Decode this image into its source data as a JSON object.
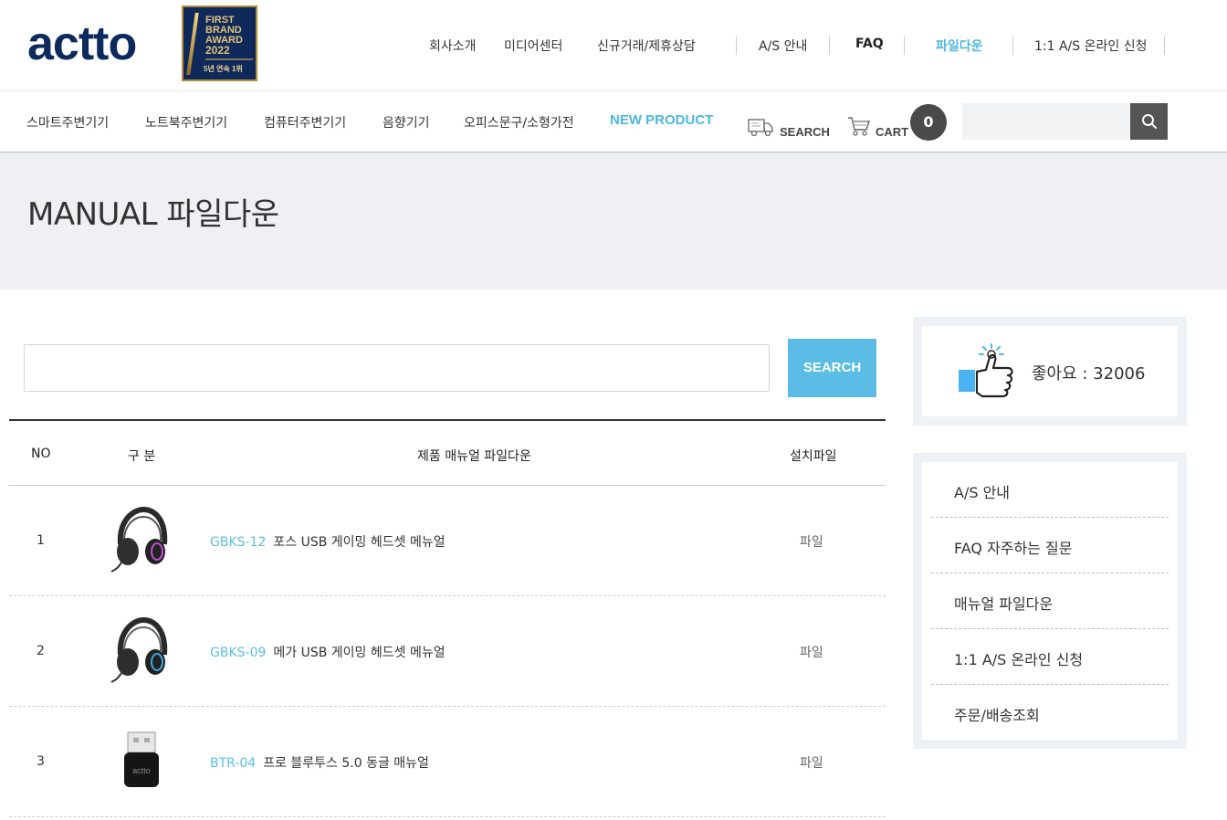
{
  "brand": {
    "logo": "actto"
  },
  "award": {
    "line1": "FIRST",
    "line2": "BRAND",
    "line3": "AWARD",
    "year": "2022",
    "sub": "5년 연속 1위"
  },
  "topnav": [
    "회사소개",
    "미디어센터",
    "신규거래/제휴상담",
    "A/S 안내",
    "FAQ",
    "파일다운",
    "1:1 A/S 온라인 신청"
  ],
  "catnav": [
    "스마트주변기기",
    "노트북주변기기",
    "컴퓨터주변기기",
    "음향기기",
    "오피스문구/소형가전",
    "NEW PRODUCT"
  ],
  "tools": {
    "search_label": "SEARCH",
    "cart_label": "CART",
    "cart_count": "0"
  },
  "page_title": "MANUAL 파일다운",
  "main_search": {
    "button": "SEARCH",
    "placeholder": ""
  },
  "table": {
    "headers": {
      "no": "NO",
      "category": "구 분",
      "title": "제품 매뉴얼 파일다운",
      "file": "설치파일"
    },
    "rows": [
      {
        "no": "1",
        "code": "GBKS-12",
        "title": "포스 USB 게이밍 헤드셋 메뉴얼",
        "file": "파일",
        "image": "headset-icon"
      },
      {
        "no": "2",
        "code": "GBKS-09",
        "title": "메가 USB 게이밍 헤드셋 메뉴얼",
        "file": "파일",
        "image": "headset-icon"
      },
      {
        "no": "3",
        "code": "BTR-04",
        "title": "프로 블루투스 5.0 동글 매뉴얼",
        "file": "파일",
        "image": "usb-dongle-icon"
      }
    ]
  },
  "like": {
    "text": "좋아요 : 32006"
  },
  "side_menu": [
    "A/S 안내",
    "FAQ 자주하는 질문",
    "매뉴얼 파일다운",
    "1:1 A/S 온라인 신청",
    "주문/배송조회"
  ],
  "colors": {
    "accent": "#5bbde5",
    "navy": "#0d2a5c",
    "banner_bg": "#eef0f3"
  }
}
